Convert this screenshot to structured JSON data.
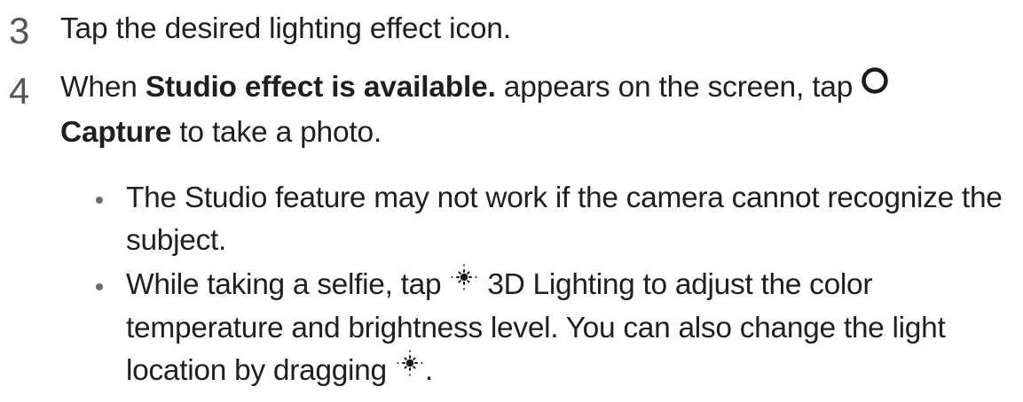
{
  "steps": [
    {
      "number": "3",
      "text": "Tap the desired lighting effect icon."
    },
    {
      "number": "4",
      "part1": "When ",
      "bold1": "Studio effect is available.",
      "part2": " appears on the screen, tap ",
      "icon": "capture-circle-icon",
      "bold2": "Capture",
      "part3": " to take a photo.",
      "bullets": [
        {
          "text": "The Studio feature may not work if the camera cannot recognize the subject."
        },
        {
          "part1": "While taking a selfie, tap ",
          "icon1": "sun-light-icon",
          "part2": " 3D Lighting to adjust the color temperature and brightness level. You can also change the light location by dragging ",
          "icon2": "sun-light-icon",
          "part3": "."
        }
      ]
    }
  ],
  "colors": {
    "text": "#1f1f1f",
    "number": "#555555",
    "bullet": "#6b6b6b"
  }
}
